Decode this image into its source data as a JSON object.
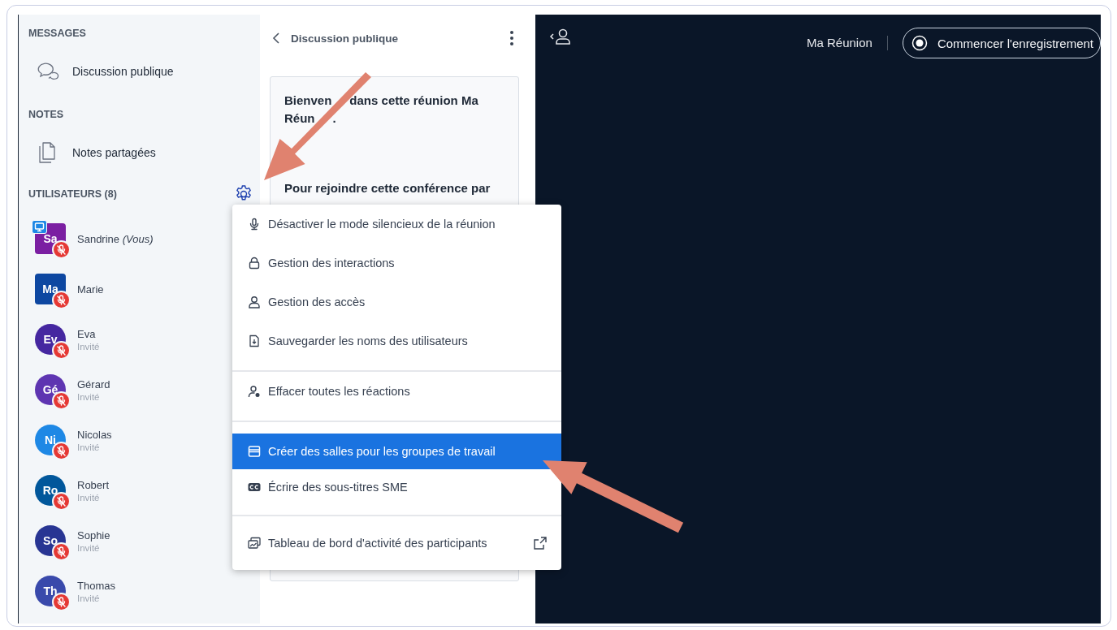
{
  "sidebar": {
    "sections": [
      {
        "title": "MESSAGES",
        "items": [
          {
            "label": "Discussion publique"
          }
        ]
      },
      {
        "title": "NOTES",
        "items": [
          {
            "label": "Notes partagées"
          }
        ]
      }
    ],
    "users_title": "UTILISATEURS (8)",
    "users": [
      {
        "initials": "Sa",
        "name": "Sandrine *(Vous)*",
        "kind": "moderator",
        "presenter": true,
        "color": "#7b1fa2"
      },
      {
        "initials": "Ma",
        "name": "Marie",
        "kind": "moderator",
        "presenter": false,
        "color": "#0d47a1"
      },
      {
        "initials": "Ev",
        "name": "Eva",
        "role": "Invité",
        "kind": "viewer",
        "presenter": false,
        "color": "#4527a0"
      },
      {
        "initials": "Gé",
        "name": "Gérard",
        "role": "Invité",
        "kind": "viewer",
        "presenter": false,
        "color": "#5e35b1"
      },
      {
        "initials": "Ni",
        "name": "Nicolas",
        "role": "Invité",
        "kind": "viewer",
        "presenter": false,
        "color": "#1e88e5"
      },
      {
        "initials": "Ro",
        "name": "Robert",
        "role": "Invité",
        "kind": "viewer",
        "presenter": false,
        "color": "#01579b"
      },
      {
        "initials": "So",
        "name": "Sophie",
        "role": "Invité",
        "kind": "viewer",
        "presenter": false,
        "color": "#283593"
      },
      {
        "initials": "Th",
        "name": "Thomas",
        "role": "Invité",
        "kind": "viewer",
        "presenter": false,
        "color": "#3949ab"
      }
    ]
  },
  "chat": {
    "title": "Discussion publique",
    "messages": [
      {
        "lines": [
          [
            "Bienven",
            "dans cette réunion Ma"
          ],
          [
            "Réun",
            "."
          ]
        ]
      },
      {
        "lines": [
          [
            "Pour rejoindre cette conférence par"
          ]
        ]
      }
    ]
  },
  "menu": {
    "groups": [
      [
        {
          "label": "Désactiver le mode silencieux de la réunion",
          "selected": false
        },
        {
          "label": "Gestion des interactions",
          "selected": false
        },
        {
          "label": "Gestion des accès",
          "selected": false
        },
        {
          "label": "Sauvegarder les noms des utilisateurs",
          "selected": false
        }
      ],
      [
        {
          "label": "Effacer toutes les réactions",
          "selected": false
        }
      ],
      [
        {
          "label": "Créer des salles pour les groupes de travail",
          "selected": true
        },
        {
          "label": "Écrire des sous-titres SME",
          "selected": false
        }
      ],
      [
        {
          "label": "Tableau de bord d'activité des participants",
          "selected": false,
          "external": true
        }
      ]
    ]
  },
  "topbar": {
    "meeting_name": "Ma Réunion",
    "record_button": "Commencer l'enregistrement"
  }
}
